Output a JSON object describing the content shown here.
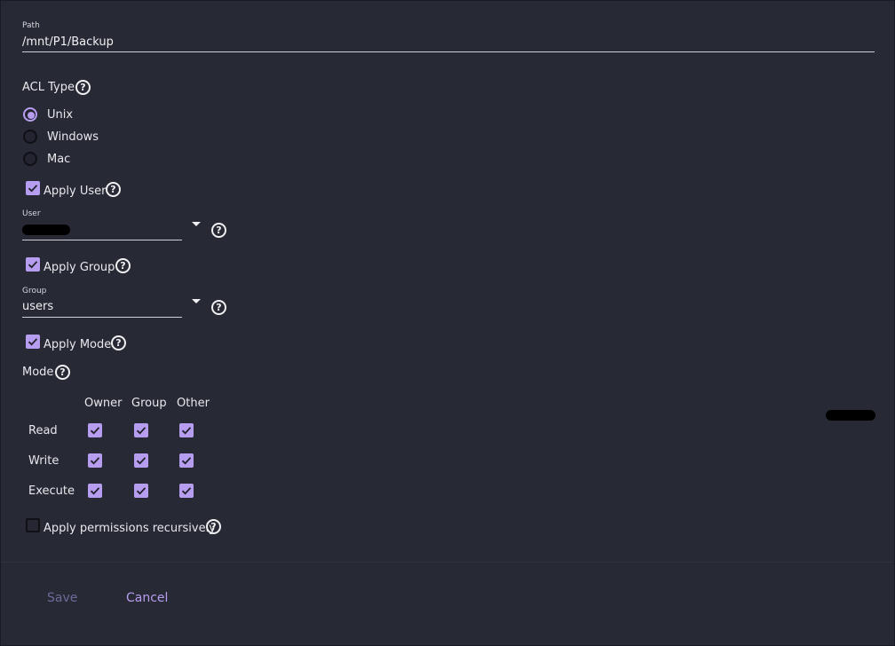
{
  "path": {
    "label": "Path",
    "value": "/mnt/P1/Backup"
  },
  "acl_type": {
    "label": "ACL Type",
    "options": [
      "Unix",
      "Windows",
      "Mac"
    ],
    "selected": "Unix"
  },
  "apply_user": {
    "label": "Apply User",
    "checked": true
  },
  "user": {
    "label": "User",
    "value": ""
  },
  "apply_group": {
    "label": "Apply Group",
    "checked": true
  },
  "group": {
    "label": "Group",
    "value": "users"
  },
  "apply_mode": {
    "label": "Apply Mode",
    "checked": true
  },
  "mode": {
    "label": "Mode",
    "columns": [
      "Owner",
      "Group",
      "Other"
    ],
    "rows": [
      {
        "label": "Read",
        "values": [
          true,
          true,
          true
        ]
      },
      {
        "label": "Write",
        "values": [
          true,
          true,
          true
        ]
      },
      {
        "label": "Execute",
        "values": [
          true,
          true,
          true
        ]
      }
    ]
  },
  "recursive": {
    "label": "Apply permissions recursively",
    "checked": false
  },
  "footer": {
    "save": "Save",
    "cancel": "Cancel"
  },
  "colors": {
    "accent": "#b79df0",
    "background": "#272935",
    "save_disabled": "#6e6a9a",
    "cancel": "#b79df0"
  },
  "icons": {
    "help": "help-circle-icon",
    "dropdown": "caret-down-icon",
    "check": "check-icon"
  }
}
